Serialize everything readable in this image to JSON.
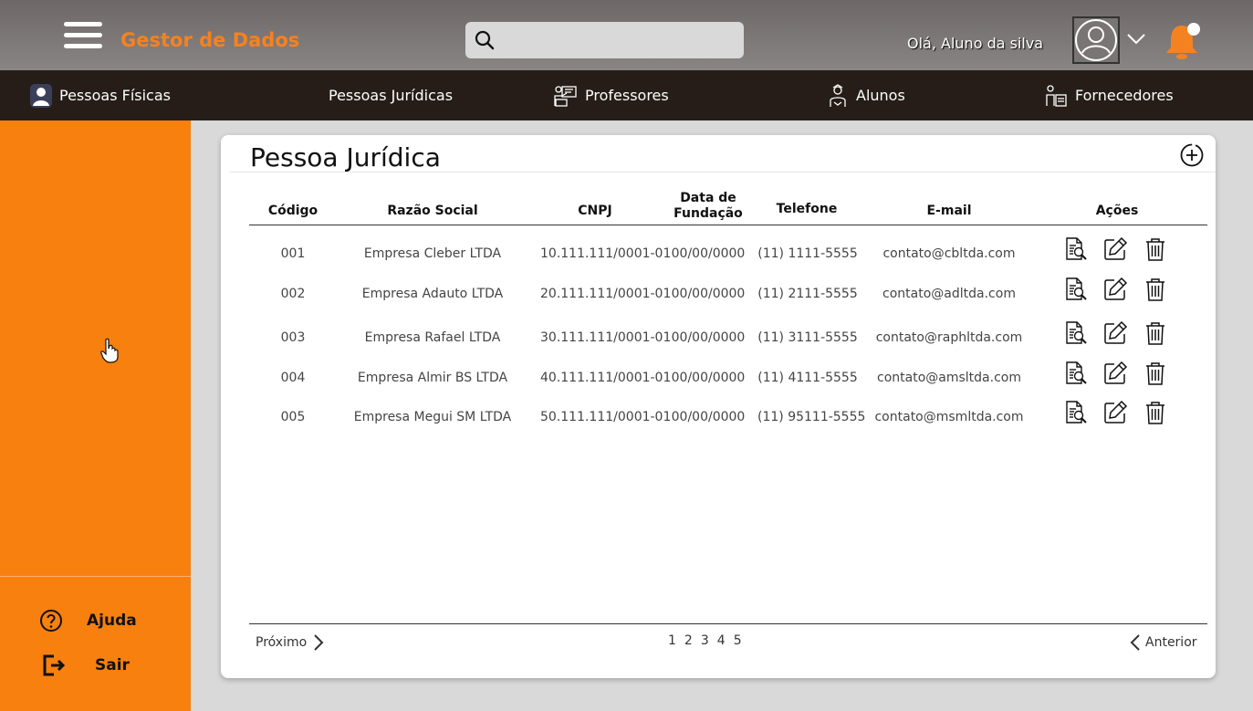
{
  "header": {
    "app_title": "Gestor de Dados",
    "search_placeholder": "",
    "greeting": "Olá, Aluno da silva"
  },
  "tabs": [
    {
      "label": "Pessoas Físicas",
      "icon": "user-icon"
    },
    {
      "label": "Pessoas Jurídicas",
      "icon": ""
    },
    {
      "label": "Professores",
      "icon": "teacher-icon"
    },
    {
      "label": "Alunos",
      "icon": "student-icon"
    },
    {
      "label": "Fornecedores",
      "icon": "supplier-icon"
    }
  ],
  "sidebar": {
    "help_label": "Ajuda",
    "logout_label": "Sair"
  },
  "card": {
    "title": "Pessoa Jurídica",
    "columns": [
      "Código",
      "Razão Social",
      "CNPJ",
      "Data de Fundação",
      "Telefone",
      "E-mail",
      "Ações"
    ],
    "column_date_line1": "Data de",
    "column_date_line2": "Fundação",
    "rows": [
      {
        "codigo": "001",
        "razao": "Empresa Cleber LTDA",
        "cnpj": "10.111.111/0001-01",
        "data": "00/00/0000",
        "telefone": "(11) 1111-5555",
        "email": "contato@cbltda.com"
      },
      {
        "codigo": "002",
        "razao": "Empresa Adauto LTDA",
        "cnpj": "20.111.111/0001-01",
        "data": "00/00/0000",
        "telefone": "(11) 2111-5555",
        "email": "contato@adltda.com"
      },
      {
        "codigo": "003",
        "razao": "Empresa Rafael LTDA",
        "cnpj": "30.111.111/0001-01",
        "data": "00/00/0000",
        "telefone": "(11) 3111-5555",
        "email": "contato@raphltda.com"
      },
      {
        "codigo": "004",
        "razao": "Empresa Almir BS LTDA",
        "cnpj": "40.111.111/0001-01",
        "data": "00/00/0000",
        "telefone": "(11) 4111-5555",
        "email": "contato@amsltda.com"
      },
      {
        "codigo": "005",
        "razao": "Empresa Megui SM LTDA",
        "cnpj": "50.111.111/0001-01",
        "data": "00/00/0000",
        "telefone": "(11) 95111-5555",
        "email": "contato@msmltda.com"
      }
    ],
    "pagination": {
      "next_label": "Próximo",
      "prev_label": "Anterior",
      "pages": [
        "1",
        "2",
        "3",
        "4",
        "5"
      ]
    }
  },
  "colors": {
    "accent": "#f58220",
    "sidebar": "#f7800f",
    "tabbar": "#261d18",
    "header": "#7a7575"
  }
}
